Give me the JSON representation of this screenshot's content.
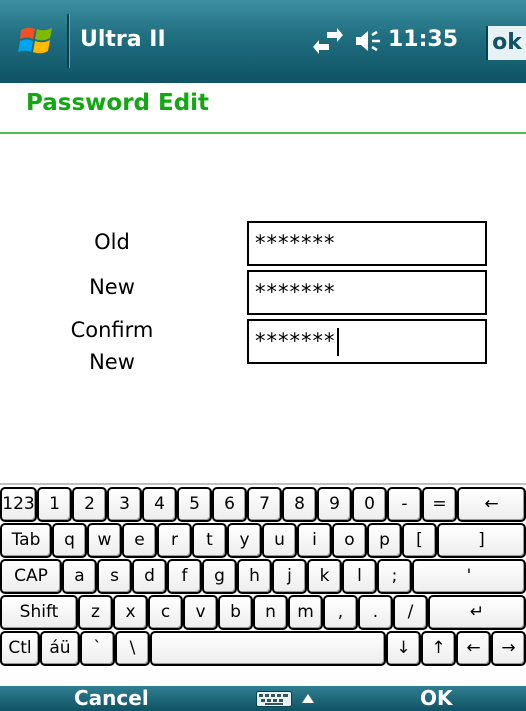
{
  "titlebar": {
    "app_title": "Ultra II",
    "time": "11:35",
    "ok_label": "ok",
    "icons": [
      "windows-start-icon",
      "connectivity-icon",
      "volume-icon"
    ]
  },
  "page": {
    "title": "Password Edit"
  },
  "form": {
    "old_label": "Old",
    "new_label": "New",
    "confirm_label_line1": "Confirm",
    "confirm_label_line2": "New",
    "old_value": "*******",
    "new_value": "*******",
    "confirm_value": "*******"
  },
  "keyboard": {
    "row1": [
      "123",
      "1",
      "2",
      "3",
      "4",
      "5",
      "6",
      "7",
      "8",
      "9",
      "0",
      "-",
      "=",
      "←"
    ],
    "row2": [
      "Tab",
      "q",
      "w",
      "e",
      "r",
      "t",
      "y",
      "u",
      "i",
      "o",
      "p",
      "[",
      "]"
    ],
    "row3": [
      "CAP",
      "a",
      "s",
      "d",
      "f",
      "g",
      "h",
      "j",
      "k",
      "l",
      ";",
      "'"
    ],
    "row4": [
      "Shift",
      "z",
      "x",
      "c",
      "v",
      "b",
      "n",
      "m",
      ",",
      ".",
      "/",
      "↵"
    ],
    "row5": [
      "Ctl",
      "áü",
      "`",
      "\\",
      "",
      "↓",
      "↑",
      "←",
      "→"
    ]
  },
  "bottombar": {
    "left_label": "Cancel",
    "right_label": "OK",
    "icons": [
      "keyboard-icon",
      "up-arrow-icon"
    ]
  },
  "colors": {
    "titlebar": "#1f6e80",
    "header_green": "#12a812",
    "rule_green": "#4cc24c"
  }
}
